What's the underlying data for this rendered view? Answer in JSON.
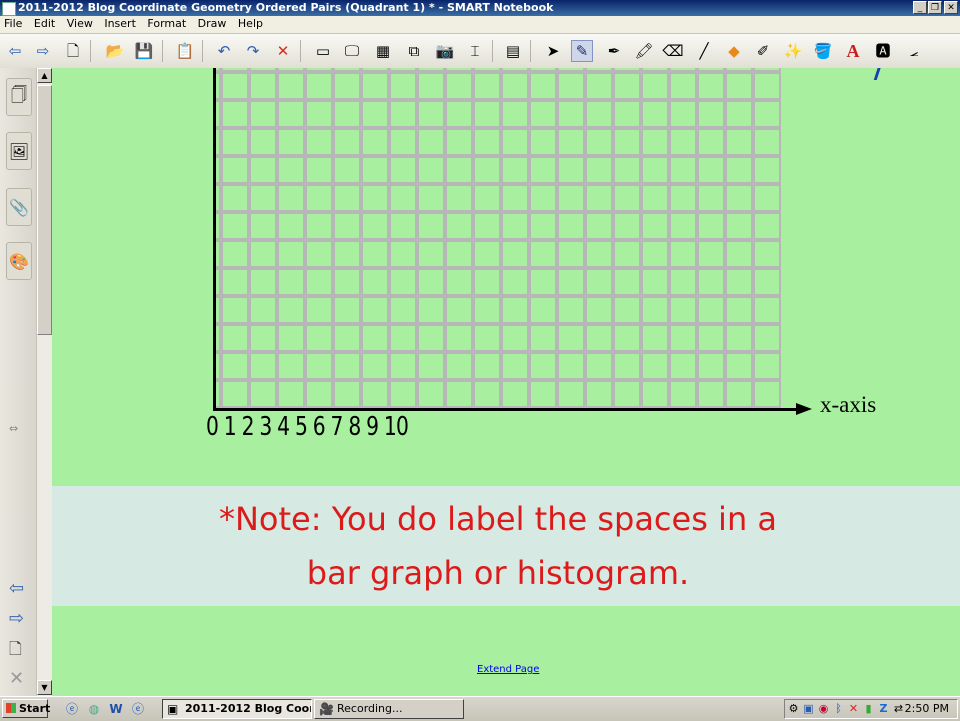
{
  "window": {
    "title": "2011-2012 Blog Coordinate Geometry Ordered Pairs (Quadrant 1) * - SMART Notebook",
    "controls": {
      "minimize": "_",
      "restore": "❐",
      "close": "✕"
    }
  },
  "menu": [
    "File",
    "Edit",
    "View",
    "Insert",
    "Format",
    "Draw",
    "Help"
  ],
  "toolbar": [
    {
      "icon": "back-arrow-icon",
      "glyph": "⇦"
    },
    {
      "icon": "forward-arrow-icon",
      "glyph": "⇨"
    },
    {
      "icon": "add-page-icon",
      "glyph": "🗋"
    },
    {
      "icon": "open-folder-icon",
      "glyph": "📂"
    },
    {
      "icon": "save-icon",
      "glyph": "💾"
    },
    {
      "icon": "paste-icon",
      "glyph": "📋"
    },
    {
      "icon": "undo-icon",
      "glyph": "↶"
    },
    {
      "icon": "redo-icon",
      "glyph": "↷"
    },
    {
      "icon": "delete-icon",
      "glyph": "✕"
    },
    {
      "icon": "screen-shade-icon",
      "glyph": "▭"
    },
    {
      "icon": "full-screen-icon",
      "glyph": "🖵"
    },
    {
      "icon": "transparent-background-icon",
      "glyph": "▦"
    },
    {
      "icon": "dual-page-icon",
      "glyph": "⧉"
    },
    {
      "icon": "capture-icon",
      "glyph": "📷"
    },
    {
      "icon": "document-camera-icon",
      "glyph": "⌶"
    },
    {
      "icon": "table-icon",
      "glyph": "▤"
    },
    {
      "icon": "select-arrow-icon",
      "glyph": "➤"
    },
    {
      "icon": "pen-icon",
      "glyph": "✎"
    },
    {
      "icon": "creative-pen-icon",
      "glyph": "✒"
    },
    {
      "icon": "highlighter-icon",
      "glyph": "🖍"
    },
    {
      "icon": "eraser-icon",
      "glyph": "⌫"
    },
    {
      "icon": "line-icon",
      "glyph": "╱"
    },
    {
      "icon": "shapes-icon",
      "glyph": "◆"
    },
    {
      "icon": "shape-pen-icon",
      "glyph": "✐"
    },
    {
      "icon": "magic-pen-icon",
      "glyph": "✨"
    },
    {
      "icon": "fill-icon",
      "glyph": "🪣"
    },
    {
      "icon": "text-icon",
      "glyph": "A"
    },
    {
      "icon": "properties-icon",
      "glyph": "🅰"
    },
    {
      "icon": "measurement-tools-icon",
      "glyph": "⦟"
    }
  ],
  "sidebar": {
    "tabs": [
      {
        "icon": "page-sorter-icon",
        "glyph": "🗍"
      },
      {
        "icon": "gallery-icon",
        "glyph": "🖼"
      },
      {
        "icon": "attachments-icon",
        "glyph": "📎"
      },
      {
        "icon": "properties-tab-icon",
        "glyph": "🎨"
      }
    ],
    "nav": [
      {
        "icon": "resize-icon",
        "glyph": "⇔"
      },
      {
        "icon": "previous-page-icon",
        "glyph": "⇦"
      },
      {
        "icon": "next-page-icon",
        "glyph": "⇨"
      },
      {
        "icon": "add-page-icon",
        "glyph": "🗋"
      },
      {
        "icon": "delete-page-icon",
        "glyph": "✕"
      }
    ]
  },
  "canvas": {
    "x_axis_label": "x-axis",
    "tick_labels": "0 1 2 3 4 5 6 7 8 9 10",
    "note_line1": "*Note:  You do label the spaces in a",
    "note_line2": "bar graph or histogram.",
    "extend_page": "Extend Page",
    "background_color": "#a8f0a0",
    "note_color": "#dd1a1a"
  },
  "taskbar": {
    "start": "Start",
    "quicklaunch": [
      {
        "icon": "ie-quicklaunch-icon",
        "glyph": "ⓔ"
      },
      {
        "icon": "browser-quicklaunch-icon",
        "glyph": "◍"
      },
      {
        "icon": "word-quicklaunch-icon",
        "glyph": "W"
      },
      {
        "icon": "explorer-quicklaunch-icon",
        "glyph": "ⓔ"
      }
    ],
    "tasks": [
      {
        "label": "2011-2012 Blog Coor...",
        "icon": "smart-notebook-task-icon",
        "glyph": "▣",
        "active": true
      },
      {
        "label": "Recording...",
        "icon": "recorder-task-icon",
        "glyph": "🎥",
        "active": false
      }
    ],
    "tray_icons": [
      {
        "icon": "network-tray-icon",
        "glyph": "⚙"
      },
      {
        "icon": "screen-tray-icon",
        "glyph": "▣"
      },
      {
        "icon": "volume-tray-icon",
        "glyph": "◉"
      },
      {
        "icon": "bluetooth-tray-icon",
        "glyph": "ᛒ"
      },
      {
        "icon": "security-tray-icon",
        "glyph": "✕"
      },
      {
        "icon": "battery-tray-icon",
        "glyph": "▮"
      },
      {
        "icon": "z-tray-icon",
        "glyph": "Z"
      },
      {
        "icon": "arrows-tray-icon",
        "glyph": "⇄"
      }
    ],
    "clock": "2:50 PM"
  }
}
